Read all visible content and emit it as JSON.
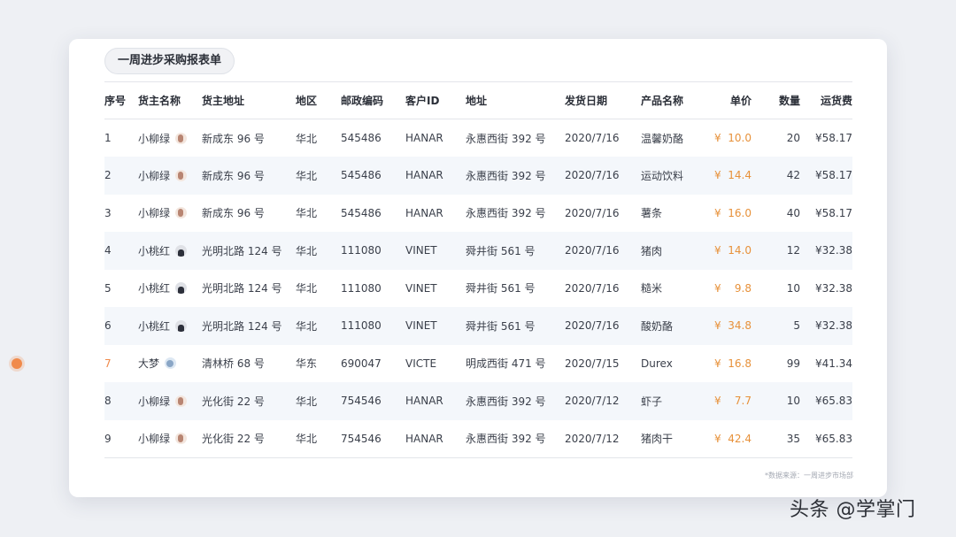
{
  "title": "一周进步采购报表单",
  "columns": [
    "序号",
    "货主名称",
    "货主地址",
    "地区",
    "邮政编码",
    "客户ID",
    "地址",
    "发货日期",
    "产品名称",
    "单价",
    "数量",
    "运货费"
  ],
  "rows": [
    {
      "idx": "1",
      "name": "小柳绿",
      "avatar": "avatar-icon-a",
      "owner_addr": "新成东 96 号",
      "region": "华北",
      "zip": "545486",
      "cust": "HANAR",
      "addr": "永惠西街 392 号",
      "date": "2020/7/16",
      "product": "温馨奶酪",
      "yen": "¥",
      "price": "10.0",
      "qty": "20",
      "freight": "¥58.17"
    },
    {
      "idx": "2",
      "name": "小柳绿",
      "avatar": "avatar-icon-a",
      "owner_addr": "新成东 96 号",
      "region": "华北",
      "zip": "545486",
      "cust": "HANAR",
      "addr": "永惠西街 392 号",
      "date": "2020/7/16",
      "product": "运动饮料",
      "yen": "¥",
      "price": "14.4",
      "qty": "42",
      "freight": "¥58.17"
    },
    {
      "idx": "3",
      "name": "小柳绿",
      "avatar": "avatar-icon-a",
      "owner_addr": "新成东 96 号",
      "region": "华北",
      "zip": "545486",
      "cust": "HANAR",
      "addr": "永惠西街 392 号",
      "date": "2020/7/16",
      "product": "薯条",
      "yen": "¥",
      "price": "16.0",
      "qty": "40",
      "freight": "¥58.17"
    },
    {
      "idx": "4",
      "name": "小桃红",
      "avatar": "avatar-icon-b",
      "owner_addr": "光明北路 124 号",
      "region": "华北",
      "zip": "111080",
      "cust": "VINET",
      "addr": "舜井街 561 号",
      "date": "2020/7/16",
      "product": "猪肉",
      "yen": "¥",
      "price": "14.0",
      "qty": "12",
      "freight": "¥32.38"
    },
    {
      "idx": "5",
      "name": "小桃红",
      "avatar": "avatar-icon-b",
      "owner_addr": "光明北路 124 号",
      "region": "华北",
      "zip": "111080",
      "cust": "VINET",
      "addr": "舜井街 561 号",
      "date": "2020/7/16",
      "product": "糙米",
      "yen": "¥",
      "price": "9.8",
      "qty": "10",
      "freight": "¥32.38"
    },
    {
      "idx": "6",
      "name": "小桃红",
      "avatar": "avatar-icon-b",
      "owner_addr": "光明北路 124 号",
      "region": "华北",
      "zip": "111080",
      "cust": "VINET",
      "addr": "舜井街 561 号",
      "date": "2020/7/16",
      "product": "酸奶酪",
      "yen": "¥",
      "price": "34.8",
      "qty": "5",
      "freight": "¥32.38"
    },
    {
      "idx": "7",
      "name": "大梦",
      "avatar": "avatar-icon-c",
      "owner_addr": "清林桥 68 号",
      "region": "华东",
      "zip": "690047",
      "cust": "VICTE",
      "addr": "明成西街 471 号",
      "date": "2020/7/15",
      "product": "Durex",
      "yen": "¥",
      "price": "16.8",
      "qty": "99",
      "freight": "¥41.34"
    },
    {
      "idx": "8",
      "name": "小柳绿",
      "avatar": "avatar-icon-a",
      "owner_addr": "光化街 22 号",
      "region": "华北",
      "zip": "754546",
      "cust": "HANAR",
      "addr": "永惠西街 392 号",
      "date": "2020/7/12",
      "product": "虾子",
      "yen": "¥",
      "price": "7.7",
      "qty": "10",
      "freight": "¥65.83"
    },
    {
      "idx": "9",
      "name": "小柳绿",
      "avatar": "avatar-icon-a",
      "owner_addr": "光化街 22 号",
      "region": "华北",
      "zip": "754546",
      "cust": "HANAR",
      "addr": "永惠西街 392 号",
      "date": "2020/7/12",
      "product": "猪肉干",
      "yen": "¥",
      "price": "42.4",
      "qty": "35",
      "freight": "¥65.83"
    }
  ],
  "highlight_row": 6,
  "source": "*数据来源：一周进步市场部",
  "watermark": "头条 @学掌门",
  "colors": {
    "accent": "#e7913a",
    "marker": "#f08a4b",
    "zebra": "#f4f7fb"
  }
}
